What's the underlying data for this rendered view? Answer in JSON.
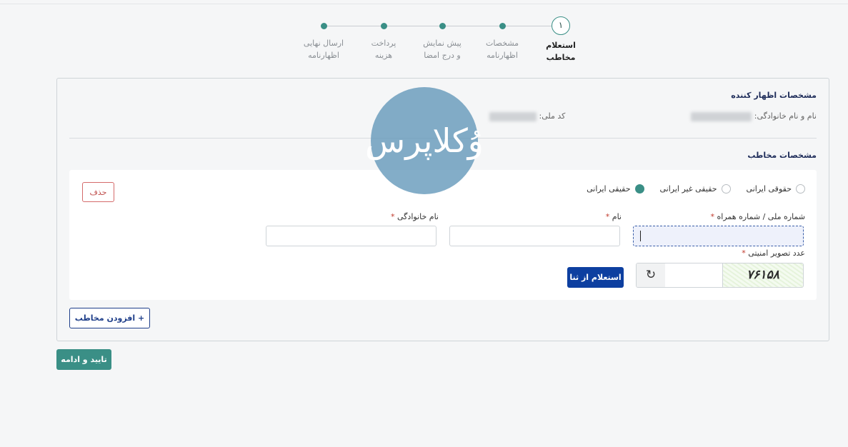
{
  "stepper": {
    "current_number": "۱",
    "steps": [
      {
        "label": "استعلام\nمخاطب",
        "state": "active"
      },
      {
        "label": "مشخصات\nاظهارنامه",
        "state": "pending"
      },
      {
        "label": "پیش نمایش\nو درج امضا",
        "state": "pending"
      },
      {
        "label": "پرداخت\nهزینه",
        "state": "pending"
      },
      {
        "label": "ارسال نهایی\nاظهارنامه",
        "state": "pending"
      }
    ]
  },
  "declarant": {
    "title": "مشخصات اظهار کننده",
    "name_label": "نام و نام خانوادگی:",
    "national_code_label": "کد ملی:"
  },
  "watermark": {
    "text": "وُکلاپرس"
  },
  "addressee": {
    "title": "مشخصات مخاطب",
    "person_types": [
      {
        "label": "حقیقی ایرانی",
        "selected": true
      },
      {
        "label": "حقیقی غیر ایرانی",
        "selected": false
      },
      {
        "label": "حقوقی ایرانی",
        "selected": false
      }
    ],
    "delete_label": "حذف",
    "national_id_label": "شماره ملی / شماره همراه",
    "first_name_label": "نام",
    "last_name_label": "نام خانوادگی",
    "required_mark": "*",
    "captcha_label": "عدد تصویر امنیتی",
    "captcha_value": "۷۶۱۵۸",
    "inquiry_button": "استعلام از ثنا"
  },
  "add_addressee_label": "افزودن مخاطب",
  "confirm_label": "تایید و ادامه",
  "colors": {
    "accent": "#3a8f86",
    "primary": "#0d3fa0",
    "danger": "#c0504d"
  }
}
